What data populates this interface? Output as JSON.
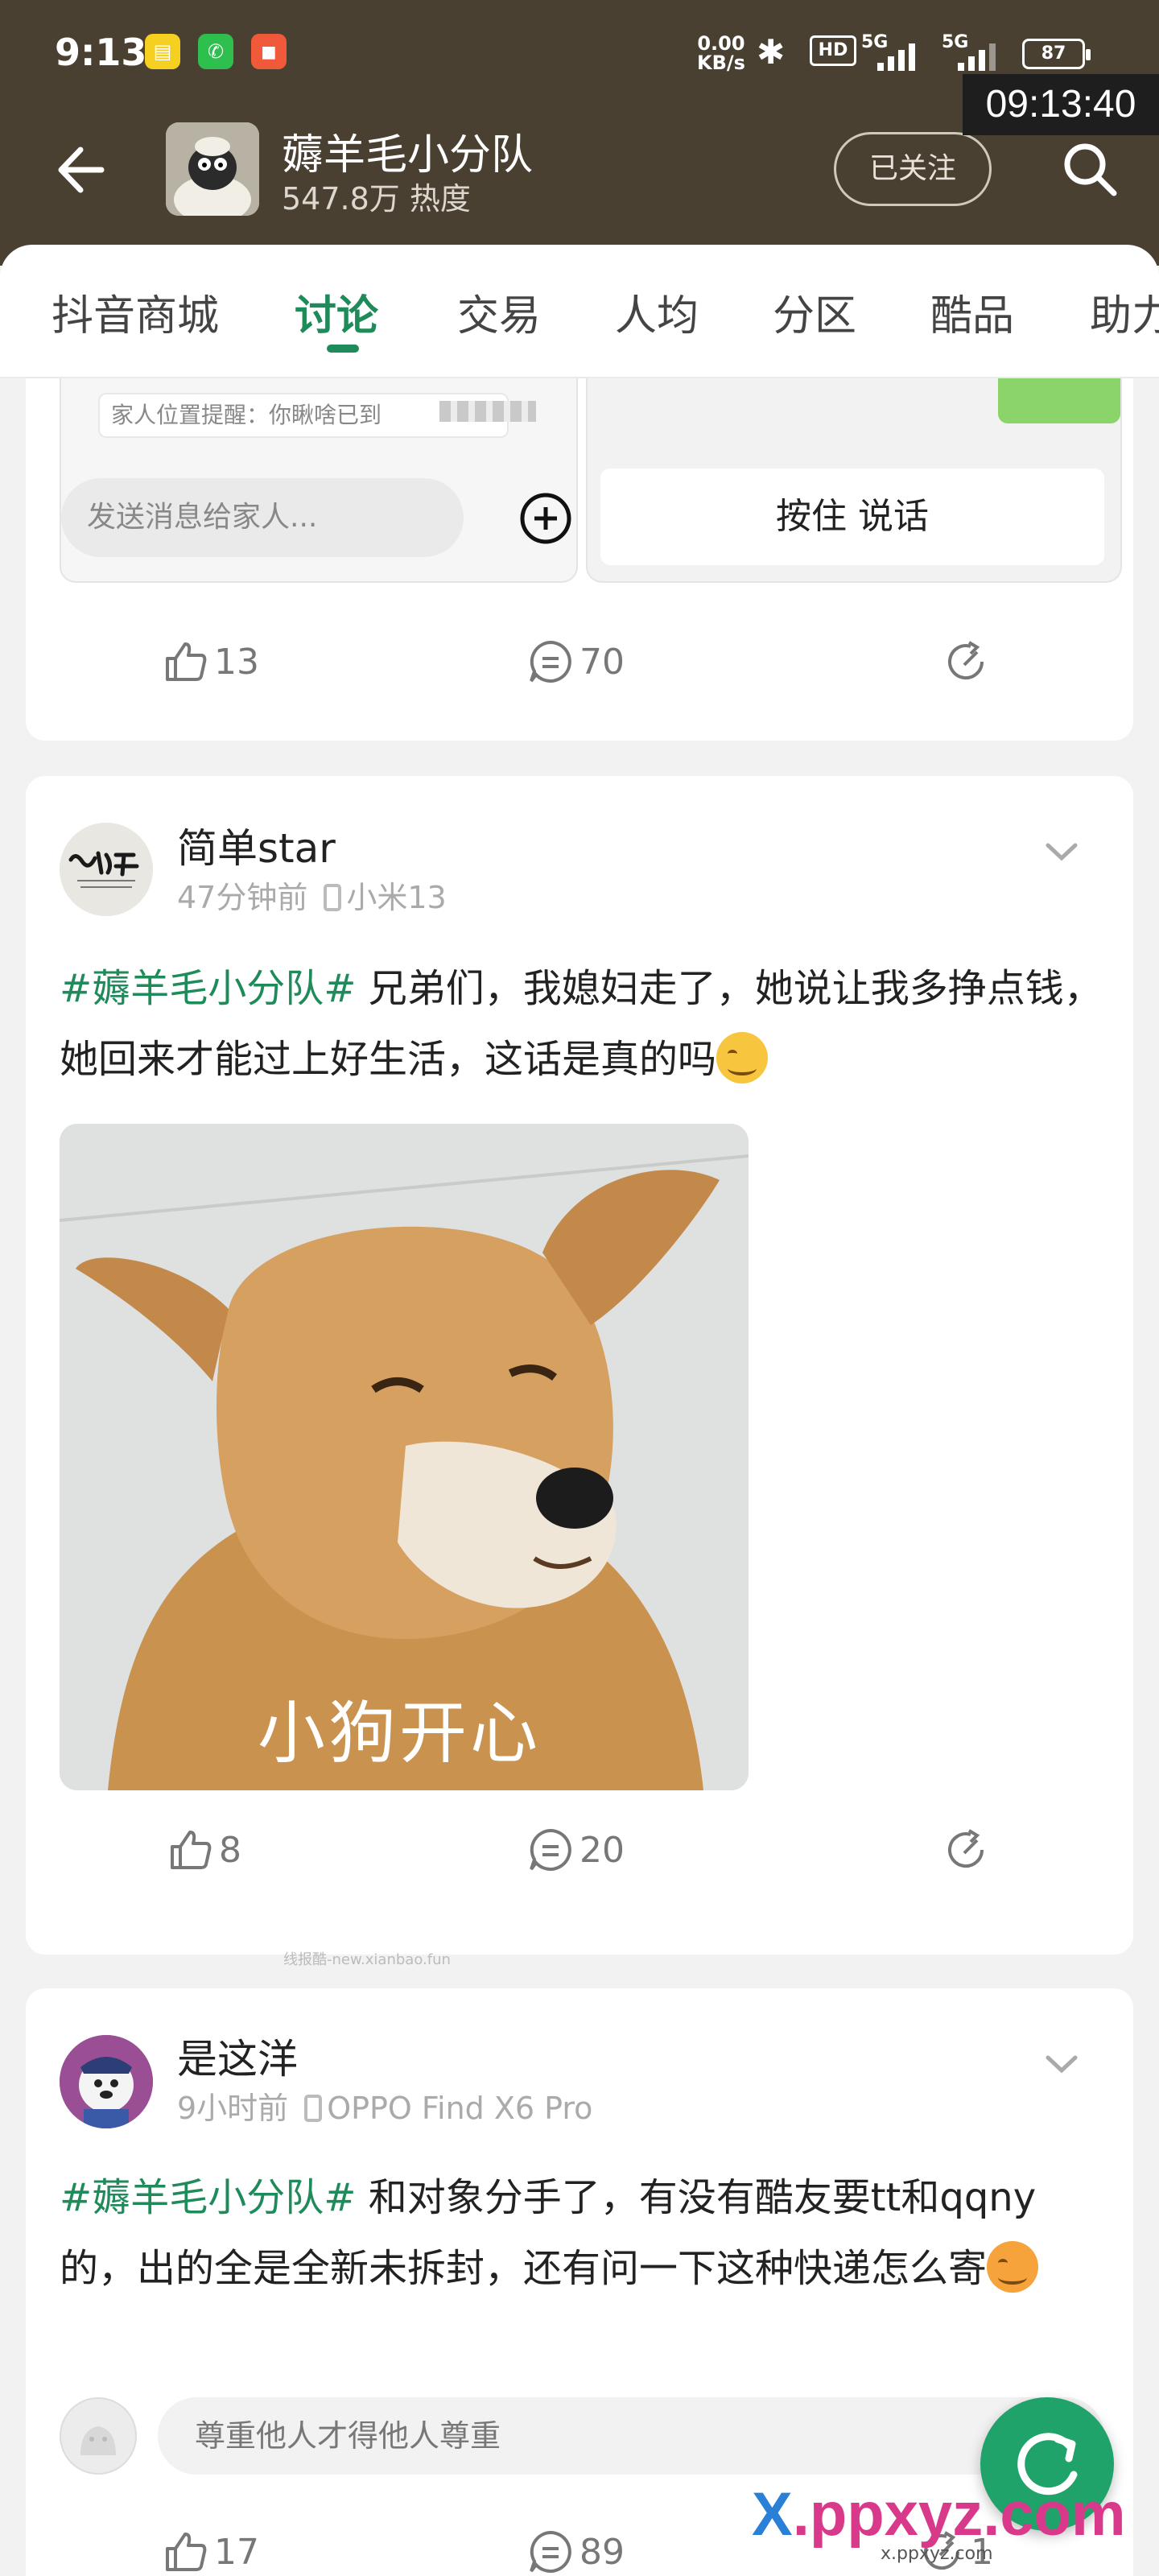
{
  "status_bar": {
    "time": "9:13",
    "net_speed_value": "0.00",
    "net_speed_unit": "KB/s",
    "hd_label": "HD",
    "signal_label_1": "5G",
    "signal_label_2": "5G",
    "battery": "87"
  },
  "overlay_clock": "09:13:40",
  "header": {
    "group_name": "薅羊毛小分队",
    "heat": "547.8万 热度",
    "follow_label": "已关注"
  },
  "tabs": [
    {
      "label": "抖音商城",
      "active": false
    },
    {
      "label": "讨论",
      "active": true
    },
    {
      "label": "交易",
      "active": false
    },
    {
      "label": "人均",
      "active": false
    },
    {
      "label": "分区",
      "active": false
    },
    {
      "label": "酷品",
      "active": false
    },
    {
      "label": "助力",
      "active": false
    }
  ],
  "post0": {
    "chat": {
      "location_reminder": "家人位置提醒：你瞅啥已到",
      "message_placeholder": "发送消息给家人...",
      "hold_to_talk": "按住 说话"
    },
    "likes": "13",
    "comments": "70"
  },
  "post1": {
    "author": "简单star",
    "time_ago": "47分钟前",
    "device": "小米13",
    "hashtag": "#薅羊毛小分队#",
    "text": " 兄弟们，我媳妇走了，她说让我多挣点钱，她回来才能过上好生活，这话是真的吗",
    "image_caption": "小狗开心",
    "likes": "8",
    "comments": "20"
  },
  "watermark_small": "线报酷-new.xianbao.fun",
  "post2": {
    "author": "是这洋",
    "time_ago": "9小时前",
    "device": "OPPO Find X6 Pro",
    "hashtag": "#薅羊毛小分队#",
    "text": " 和对象分手了，有没有酷友要tt和qqny的，出的全是全新未拆封，还有问一下这种快递怎么寄",
    "comment_placeholder": "尊重他人才得他人尊重",
    "likes": "17",
    "comments": "89",
    "shares": "1"
  },
  "brand_watermark": {
    "x": "X",
    "rest": ".ppxyz.com",
    "sub": "x.ppxyz.com"
  },
  "colors": {
    "header_bg": "#4a4032",
    "accent_green": "#1f8a5a",
    "hashtag_green": "#1f8a5a",
    "fab_green": "#1fa36a"
  }
}
